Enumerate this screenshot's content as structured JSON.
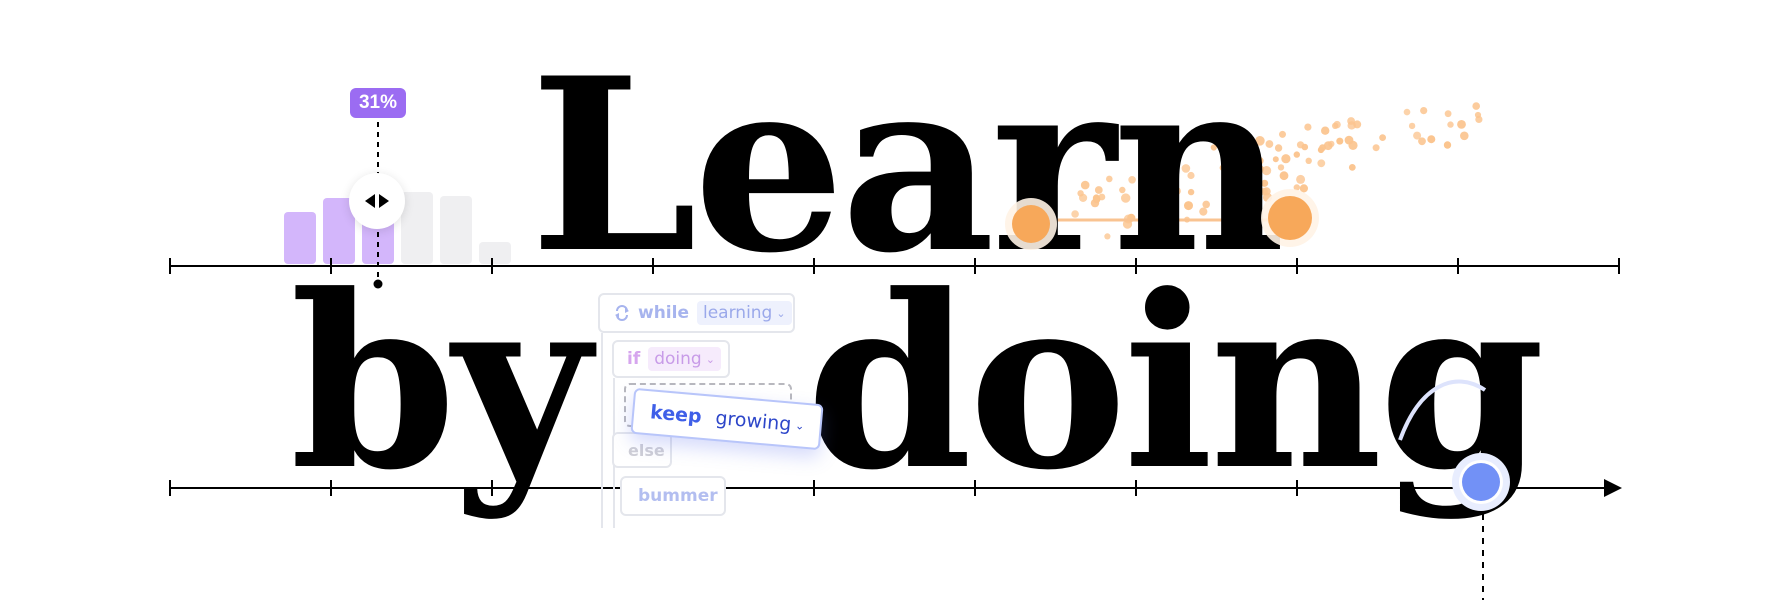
{
  "headline": {
    "line1_word": "Learn",
    "line2_word1": "by",
    "line2_word2": "doing"
  },
  "percent_badge": {
    "value": "31%",
    "level": 0.31,
    "color": "#9b6cf2"
  },
  "mini_bars": {
    "values": [
      0.52,
      0.66,
      0.58,
      0.72,
      0.68,
      0.22
    ],
    "highlighted_count": 3,
    "accent": "#d3b6fb",
    "muted": "#efeff1"
  },
  "code_blocks": {
    "while": {
      "keyword": "while",
      "value": "learning",
      "icon": "loop-icon"
    },
    "if": {
      "keyword": "if",
      "value": "doing"
    },
    "keep": {
      "keyword": "keep",
      "value": "growing"
    },
    "else": {
      "keyword": "else"
    },
    "bummer": {
      "keyword": "bummer"
    }
  },
  "colors": {
    "orange": "#f7a85a",
    "orange_light": "#fbd0a3",
    "blue": "#7291f6",
    "axis": "#000000"
  }
}
